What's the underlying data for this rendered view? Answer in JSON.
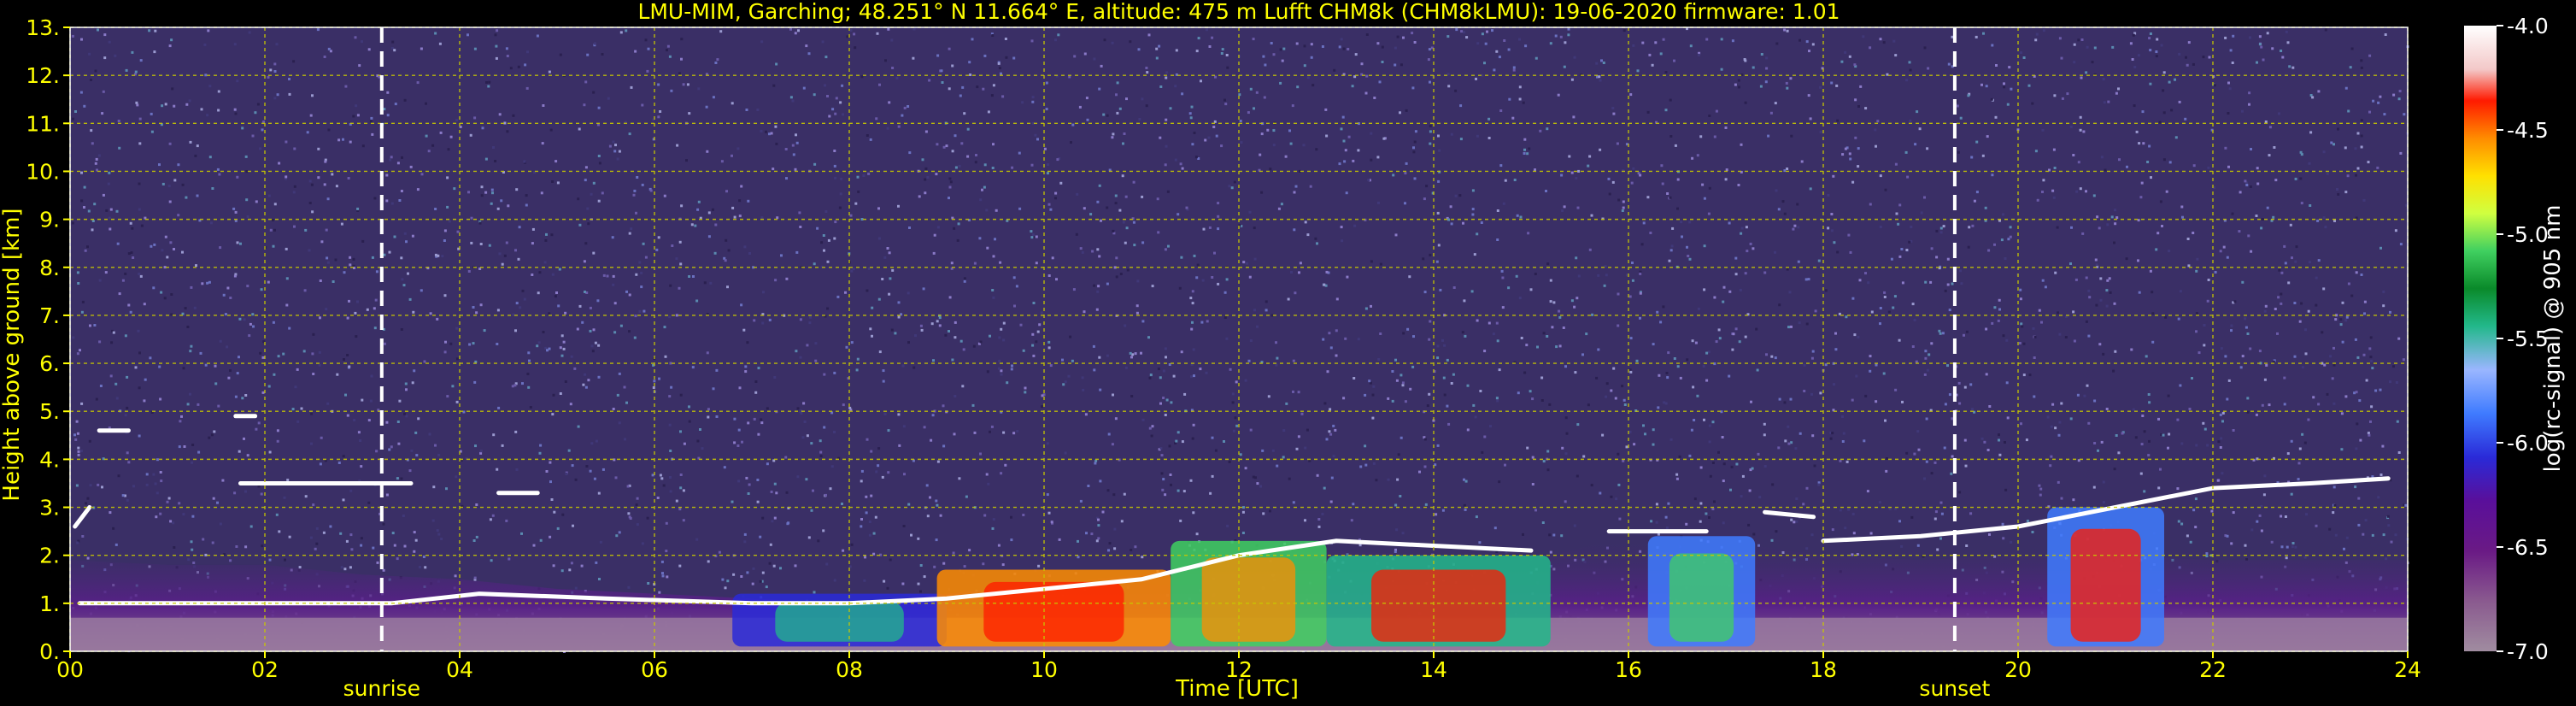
{
  "chart_data": {
    "type": "heatmap",
    "title": "LMU-MIM, Garching; 48.251° N 11.664° E, altitude: 475 m    Lufft CHM8k (CHM8kLMU): 19-06-2020    firmware: 1.01",
    "xlabel": "Time [UTC]",
    "ylabel": "Height above ground [km]",
    "xlim": [
      0,
      24
    ],
    "ylim": [
      0,
      13
    ],
    "x_ticks": [
      "00",
      "02",
      "04",
      "06",
      "08",
      "10",
      "12",
      "14",
      "16",
      "18",
      "20",
      "22",
      "24"
    ],
    "y_ticks": [
      "0.",
      "1.",
      "2.",
      "3.",
      "4.",
      "5.",
      "6.",
      "7.",
      "8.",
      "9.",
      "10.",
      "11.",
      "12.",
      "13."
    ],
    "grid": true,
    "colorbar": {
      "label": "log(rc-signal) @ 905 nm",
      "range": [
        -7.0,
        -4.0
      ],
      "ticks": [
        "-4.0",
        "-4.5",
        "-5.0",
        "-5.5",
        "-6.0",
        "-6.5",
        "-7.0"
      ]
    },
    "annotations": [
      {
        "label": "sunrise",
        "x": 3.2
      },
      {
        "label": "sunset",
        "x": 19.35
      }
    ],
    "colors": {
      "axis_text": "#ffff00",
      "grid": "#c8c800",
      "background": "#000000",
      "noise_base": "#3a2f66"
    }
  }
}
